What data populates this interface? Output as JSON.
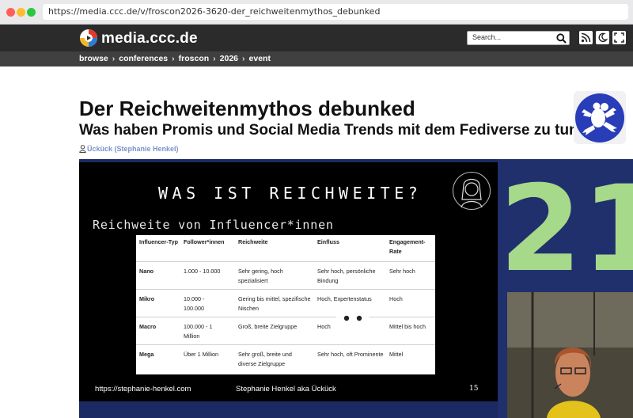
{
  "browser": {
    "url": "https://media.ccc.de/v/froscon2026-3620-der_reichweitenmythos_debunked"
  },
  "header": {
    "logo_text": "media.ccc.de",
    "search_placeholder": "Search...",
    "icons": [
      "rss-icon",
      "moon-icon",
      "fullscreen-icon"
    ]
  },
  "breadcrumb": {
    "items": [
      "browse",
      "conferences",
      "froscon",
      "2026",
      "event"
    ],
    "separator": "›"
  },
  "talk": {
    "title": "Der Reichweitenmythos debunked",
    "subtitle": "Was haben Promis und Social Media Trends mit dem Fediverse zu tun?",
    "speaker": "Ückück (Stephanie Henkel)"
  },
  "slide": {
    "heading": "WAS IST REICHWEITE?",
    "subheading": "Reichweite von Influencer*innen",
    "table": {
      "headers": [
        "Influencer-Typ",
        "Follower*innen",
        "Reichweite",
        "Einfluss",
        "Engagement-Rate"
      ],
      "rows": [
        [
          "Nano",
          "1.000 - 10.000",
          "Sehr gering, hoch spezialisiert",
          "Sehr hoch, persönliche Bindung",
          "Sehr hoch"
        ],
        [
          "Mikro",
          "10.000 - 100.000",
          "Gering bis mittel, spezifische Nischen",
          "Hoch, Expertenstatus",
          "Hoch"
        ],
        [
          "Macro",
          "100.000 - 1 Million",
          "Groß, breite Zielgruppe",
          "Hoch",
          "Mittel bis hoch"
        ],
        [
          "Mega",
          "Über 1 Million",
          "Sehr groß, breite und diverse Zielgruppe",
          "Sehr hoch, oft Prominente",
          "Mittel"
        ]
      ]
    },
    "footer_left": "https://stephanie-henkel.com",
    "footer_center": "Stephanie Henkel aka Ückück",
    "page_number": "15"
  },
  "stage": {
    "backdrop_text": "21"
  },
  "colors": {
    "header_bg": "#2b2b2b",
    "breadcrumb_bg": "#404040",
    "speaker_link": "#7a93c8",
    "stage_green": "#a6d98a",
    "stage_blue": "#20306d",
    "froscon_blue": "#2a3db8"
  }
}
